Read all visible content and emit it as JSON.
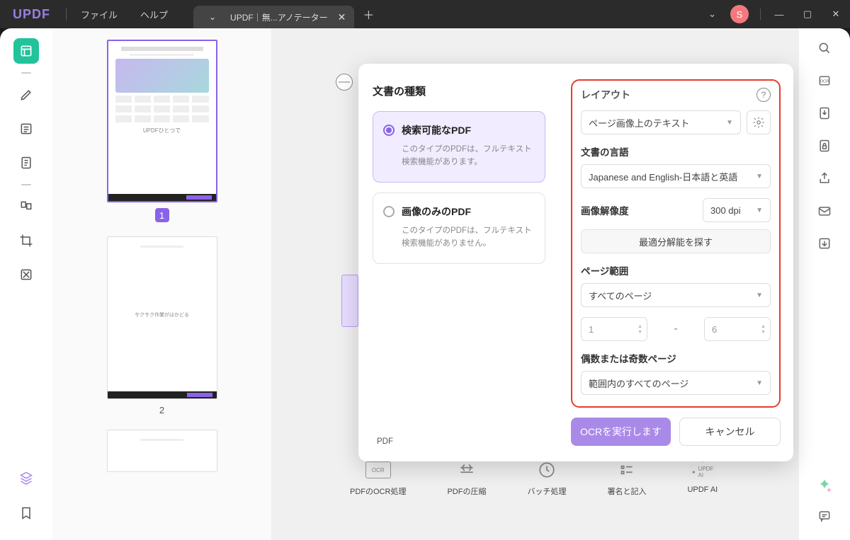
{
  "titlebar": {
    "logo": "UPDF",
    "menus": {
      "file": "ファイル",
      "help": "ヘルプ"
    },
    "tab": {
      "title": "UPDF｜無...アノテーター"
    },
    "avatar_initial": "S"
  },
  "thumbnails": {
    "page1": {
      "number": "1",
      "caption": "UPDFひとつで"
    },
    "page2": {
      "number": "2",
      "caption": "サクサク作業がはかどる"
    }
  },
  "features": {
    "ocr": "PDFのOCR処理",
    "compress": "PDFの圧縮",
    "batch": "バッチ処理",
    "sign": "署名と記入",
    "ai": "UPDF AI",
    "ai_chip": "UPDF AI"
  },
  "ocr_popup": {
    "left": {
      "section_title": "文書の種類",
      "type_searchable": {
        "title": "検索可能なPDF",
        "desc": "このタイプのPDFは、フルテキスト検索機能があります。"
      },
      "type_image": {
        "title": "画像のみのPDF",
        "desc": "このタイプのPDFは、フルテキスト検索機能がありません。"
      },
      "truncated": "PDF"
    },
    "right": {
      "layout_title": "レイアウト",
      "layout_value": "ページ画像上のテキスト",
      "lang_label": "文書の言語",
      "lang_value": "Japanese and English-日本語と英語",
      "resolution_label": "画像解像度",
      "resolution_value": "300 dpi",
      "find_optimal": "最適分解能を探す",
      "range_label": "ページ範囲",
      "range_value": "すべてのページ",
      "range_from": "1",
      "range_to": "6",
      "odd_even_label": "偶数または奇数ページ",
      "odd_even_value": "範囲内のすべてのページ",
      "run": "OCRを実行します",
      "cancel": "キャンセル"
    }
  }
}
